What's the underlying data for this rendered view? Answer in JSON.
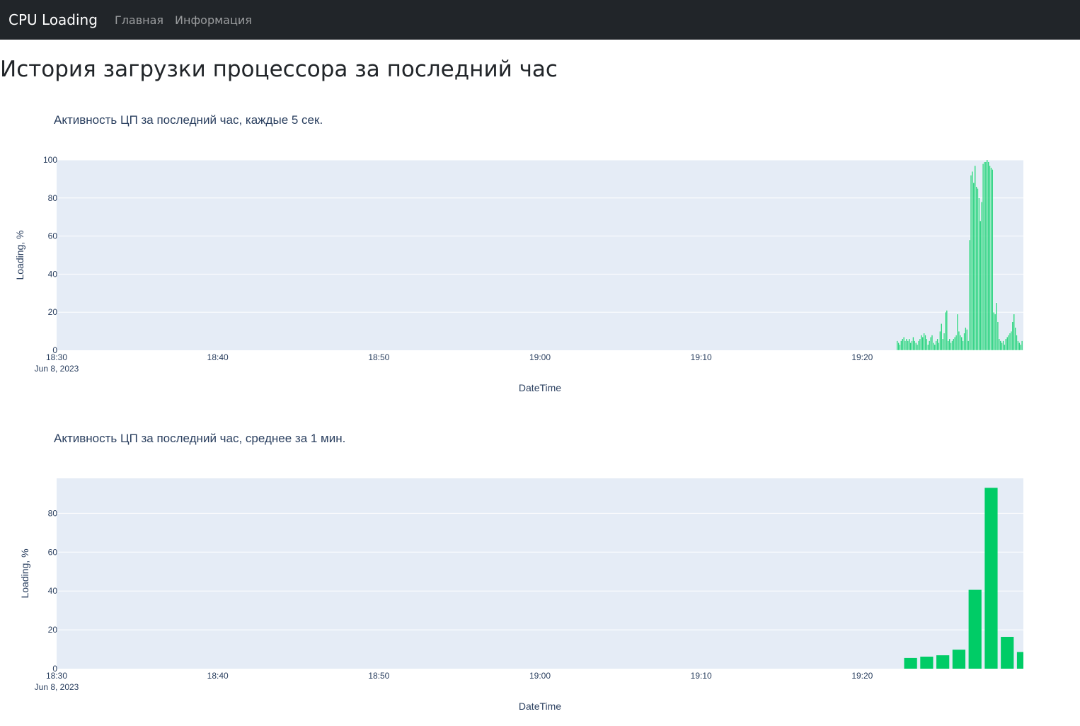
{
  "navbar": {
    "brand": "CPU Loading",
    "links": [
      "Главная",
      "Информация"
    ]
  },
  "page_title": "История загрузки процессора за последний час",
  "colors": {
    "navbar_bg": "#212529",
    "plot_bg": "#e5ecf6",
    "bar": "#00cc66",
    "text": "#2a3f5f"
  },
  "chart_data": [
    {
      "type": "bar",
      "title": "Активность ЦП за последний час, каждые 5 сек.",
      "xlabel": "DateTime",
      "ylabel": "Loading, %",
      "xlim": [
        "2023-06-08 18:30",
        "2023-06-08 19:30"
      ],
      "ylim": [
        0,
        100
      ],
      "x_ticks": [
        "18:30",
        "18:40",
        "18:50",
        "19:00",
        "19:10",
        "19:20"
      ],
      "x_tick_sublabel": "Jun 8, 2023",
      "y_ticks": [
        0,
        20,
        40,
        60,
        80,
        100
      ],
      "grid": true,
      "interval": "5s",
      "start": "2023-06-08 19:22:10",
      "values": [
        5,
        4,
        3,
        5,
        6,
        7,
        5,
        6,
        5,
        6,
        4,
        5,
        7,
        5,
        4,
        3,
        5,
        6,
        8,
        7,
        9,
        8,
        6,
        3,
        5,
        7,
        8,
        4,
        3,
        5,
        6,
        4,
        10,
        14,
        6,
        9,
        20,
        21,
        5,
        6,
        4,
        5,
        6,
        7,
        8,
        19,
        10,
        8,
        7,
        5,
        9,
        12,
        11,
        5,
        58,
        92,
        94,
        88,
        97,
        86,
        85,
        80,
        68,
        78,
        98,
        99,
        99,
        100,
        99,
        97,
        96,
        95,
        20,
        19,
        25,
        15,
        6,
        5,
        4,
        5,
        3,
        6,
        7,
        8,
        9,
        10,
        15,
        19,
        12,
        8,
        5,
        4,
        3,
        5,
        6,
        9
      ]
    },
    {
      "type": "bar",
      "title": "Активность ЦП за последний час, среднее за 1 мин.",
      "xlabel": "DateTime",
      "ylabel": "Loading, %",
      "xlim": [
        "2023-06-08 18:30",
        "2023-06-08 19:30"
      ],
      "ylim": [
        0,
        98
      ],
      "x_ticks": [
        "18:30",
        "18:40",
        "18:50",
        "19:00",
        "19:10",
        "19:20"
      ],
      "x_tick_sublabel": "Jun 8, 2023",
      "y_ticks": [
        0,
        20,
        40,
        60,
        80
      ],
      "grid": true,
      "interval": "1min",
      "categories": [
        "19:23",
        "19:24",
        "19:25",
        "19:26",
        "19:27",
        "19:28",
        "19:29",
        "19:30"
      ],
      "values": [
        5.5,
        6.2,
        6.9,
        9.8,
        40.6,
        93.1,
        16.4,
        8.6
      ]
    }
  ]
}
